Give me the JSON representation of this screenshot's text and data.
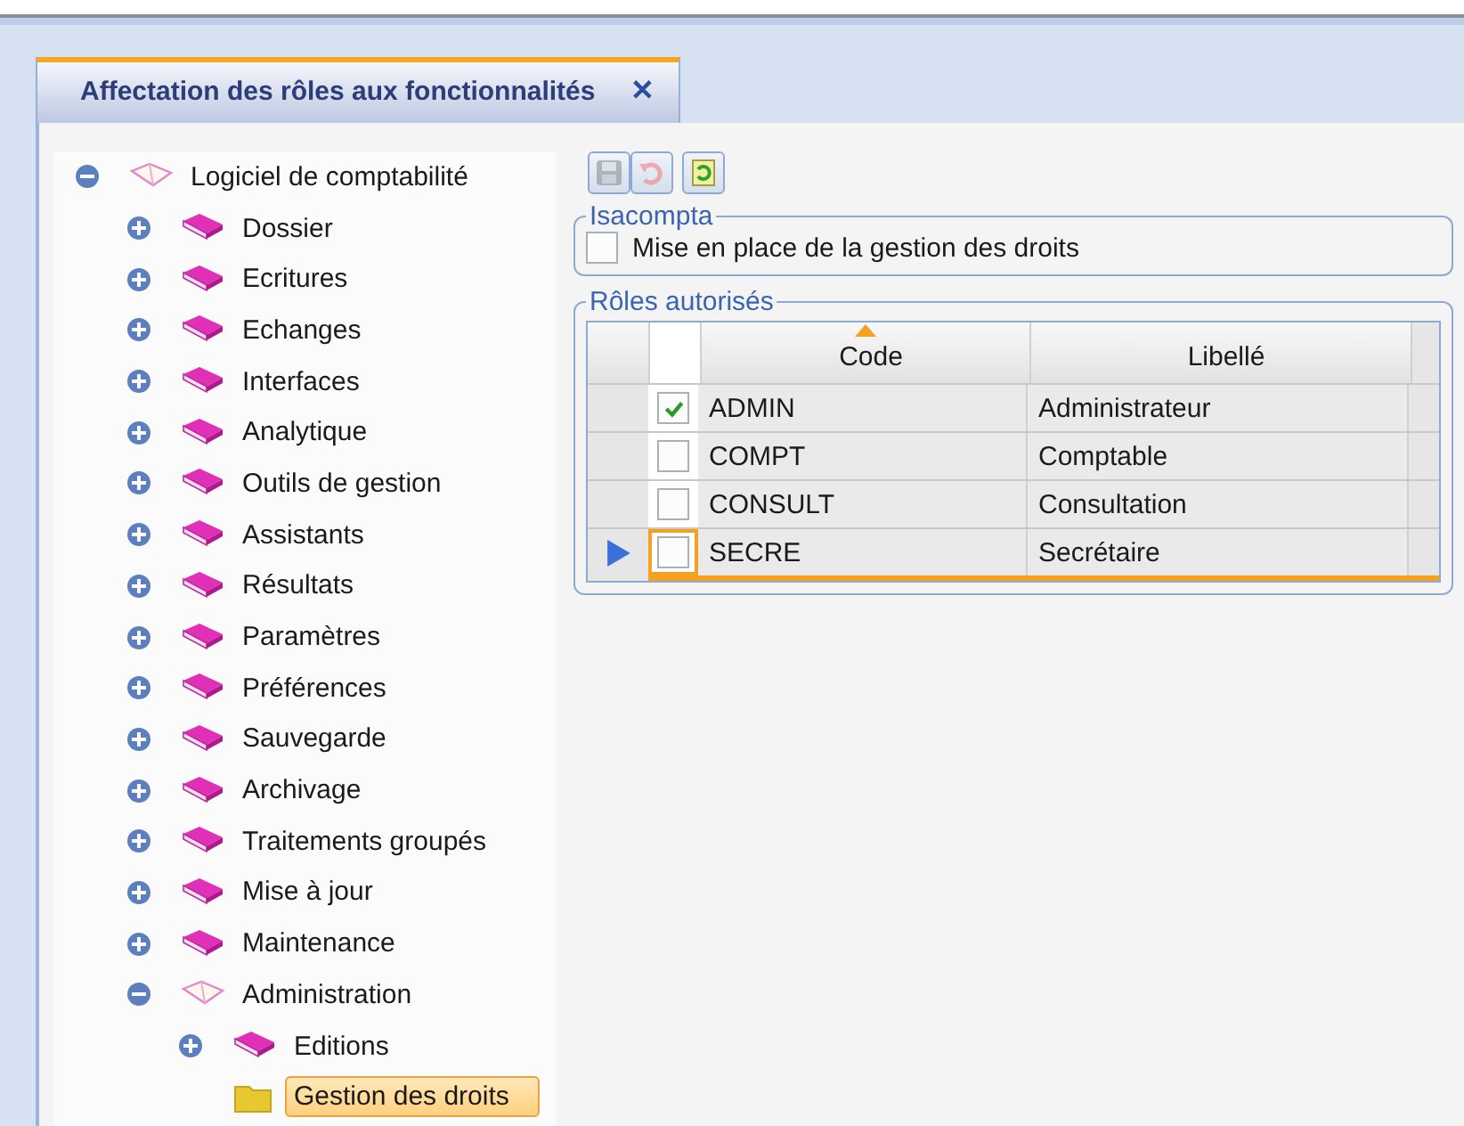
{
  "tab": {
    "title": "Affectation des rôles aux fonctionnalités",
    "close": "✕",
    "selected": true
  },
  "tree": [
    {
      "label": "Logiciel de comptabilité",
      "kind": "book",
      "expanded": true,
      "selected": false,
      "children": [
        {
          "label": "Dossier",
          "kind": "book",
          "expanded": false,
          "selected": false
        },
        {
          "label": "Ecritures",
          "kind": "book",
          "expanded": false,
          "selected": false
        },
        {
          "label": "Echanges",
          "kind": "book",
          "expanded": false,
          "selected": false
        },
        {
          "label": "Interfaces",
          "kind": "book",
          "expanded": false,
          "selected": false
        },
        {
          "label": "Analytique",
          "kind": "book",
          "expanded": false,
          "selected": false
        },
        {
          "label": "Outils de gestion",
          "kind": "book",
          "expanded": false,
          "selected": false
        },
        {
          "label": "Assistants",
          "kind": "book",
          "expanded": false,
          "selected": false
        },
        {
          "label": "Résultats",
          "kind": "book",
          "expanded": false,
          "selected": false
        },
        {
          "label": "Paramètres",
          "kind": "book",
          "expanded": false,
          "selected": false
        },
        {
          "label": "Préférences",
          "kind": "book",
          "expanded": false,
          "selected": false
        },
        {
          "label": "Sauvegarde",
          "kind": "book",
          "expanded": false,
          "selected": false
        },
        {
          "label": "Archivage",
          "kind": "book",
          "expanded": false,
          "selected": false
        },
        {
          "label": "Traitements groupés",
          "kind": "book",
          "expanded": false,
          "selected": false
        },
        {
          "label": "Mise à jour",
          "kind": "book",
          "expanded": false,
          "selected": false
        },
        {
          "label": "Maintenance",
          "kind": "book",
          "expanded": false,
          "selected": false
        },
        {
          "label": "Administration",
          "kind": "book",
          "expanded": true,
          "selected": false,
          "children": [
            {
              "label": "Editions",
              "kind": "book",
              "expanded": false,
              "selected": false
            },
            {
              "label": "Gestion des droits",
              "kind": "folder",
              "selected": true
            }
          ]
        }
      ]
    }
  ],
  "toolbar": [
    {
      "kind": "save",
      "disabled": true
    },
    {
      "kind": "undo",
      "disabled": true
    },
    {
      "kind": "refresh",
      "disabled": false
    }
  ],
  "isacompta": {
    "legend": "Isacompta",
    "option": {
      "label": "Mise en place de la gestion des droits",
      "checked": false
    }
  },
  "roles": {
    "legend": "Rôles autorisés",
    "columns": [
      {
        "label": "Code",
        "sorted": true
      },
      {
        "label": "Libellé",
        "sorted": false
      }
    ],
    "rows": [
      {
        "checked": true,
        "code": "ADMIN",
        "label": "Administrateur",
        "selected": false
      },
      {
        "checked": false,
        "code": "COMPT",
        "label": "Comptable",
        "selected": false
      },
      {
        "checked": false,
        "code": "CONSULT",
        "label": "Consultation",
        "selected": false
      },
      {
        "checked": false,
        "code": "SECRE",
        "label": "Secrétaire",
        "selected": true
      }
    ]
  }
}
